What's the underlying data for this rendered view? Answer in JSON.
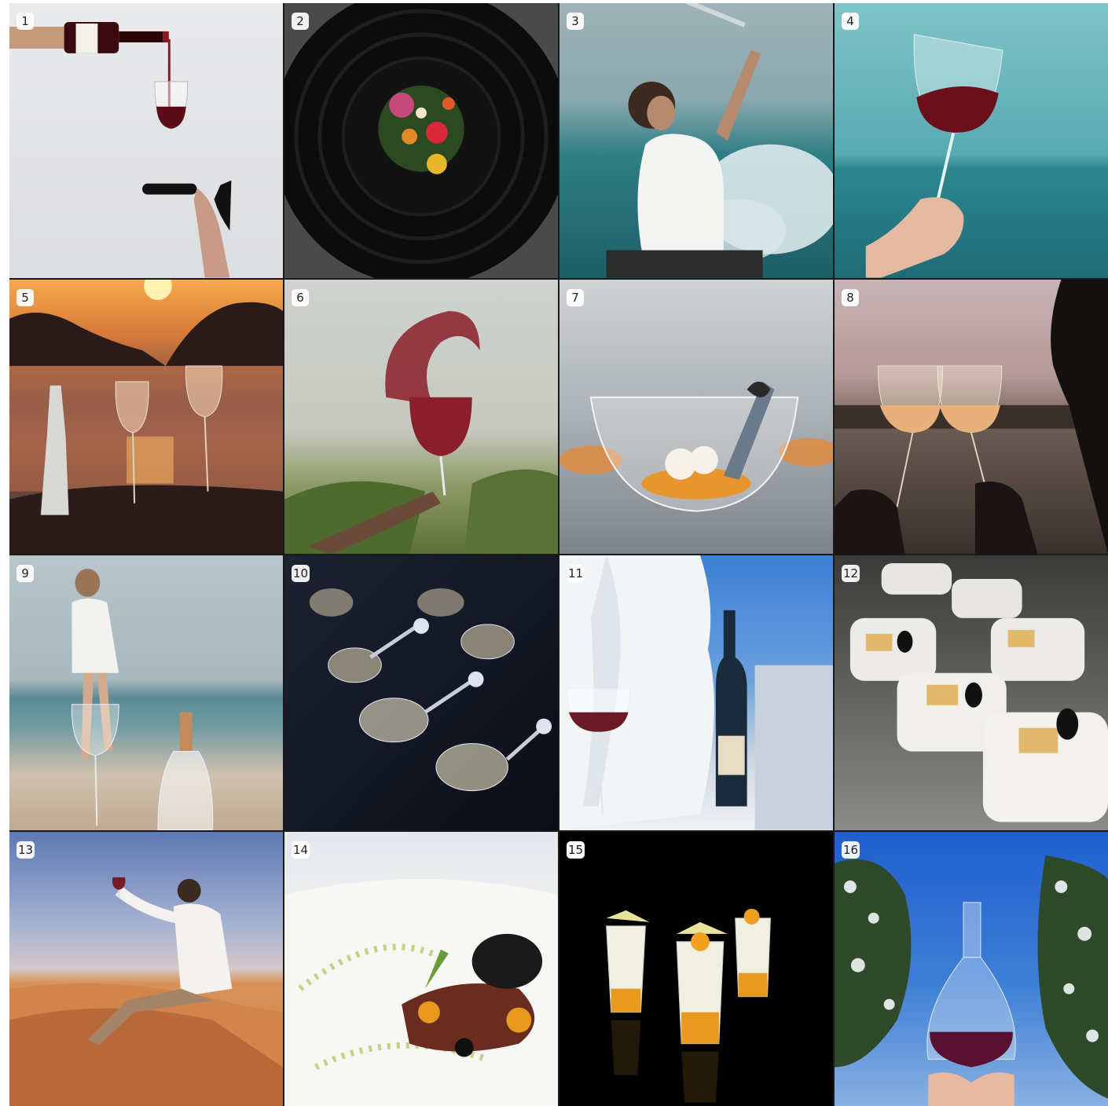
{
  "tiles": [
    {
      "number": "1",
      "subject": "wine-pour-heel"
    },
    {
      "number": "2",
      "subject": "black-plate-flowers"
    },
    {
      "number": "3",
      "subject": "woman-sea-splash"
    },
    {
      "number": "4",
      "subject": "glass-over-sea"
    },
    {
      "number": "5",
      "subject": "sunset-beach-glasses"
    },
    {
      "number": "6",
      "subject": "wine-splash"
    },
    {
      "number": "7",
      "subject": "glass-bowl-dessert"
    },
    {
      "number": "8",
      "subject": "silhouette-toast"
    },
    {
      "number": "9",
      "subject": "woman-beach-bottle"
    },
    {
      "number": "10",
      "subject": "spoons-spheres"
    },
    {
      "number": "11",
      "subject": "ice-wine-bottle"
    },
    {
      "number": "12",
      "subject": "caviar-bites"
    },
    {
      "number": "13",
      "subject": "man-dune-glass"
    },
    {
      "number": "14",
      "subject": "dessert-plate"
    },
    {
      "number": "15",
      "subject": "verrines-black"
    },
    {
      "number": "16",
      "subject": "decanter-snow"
    }
  ],
  "colors": {
    "wine": "#6b0f1a",
    "sea": "#2f8a94",
    "sunset": "#e58a3a",
    "sand": "#d9935a",
    "sky": "#3d7fd6"
  }
}
